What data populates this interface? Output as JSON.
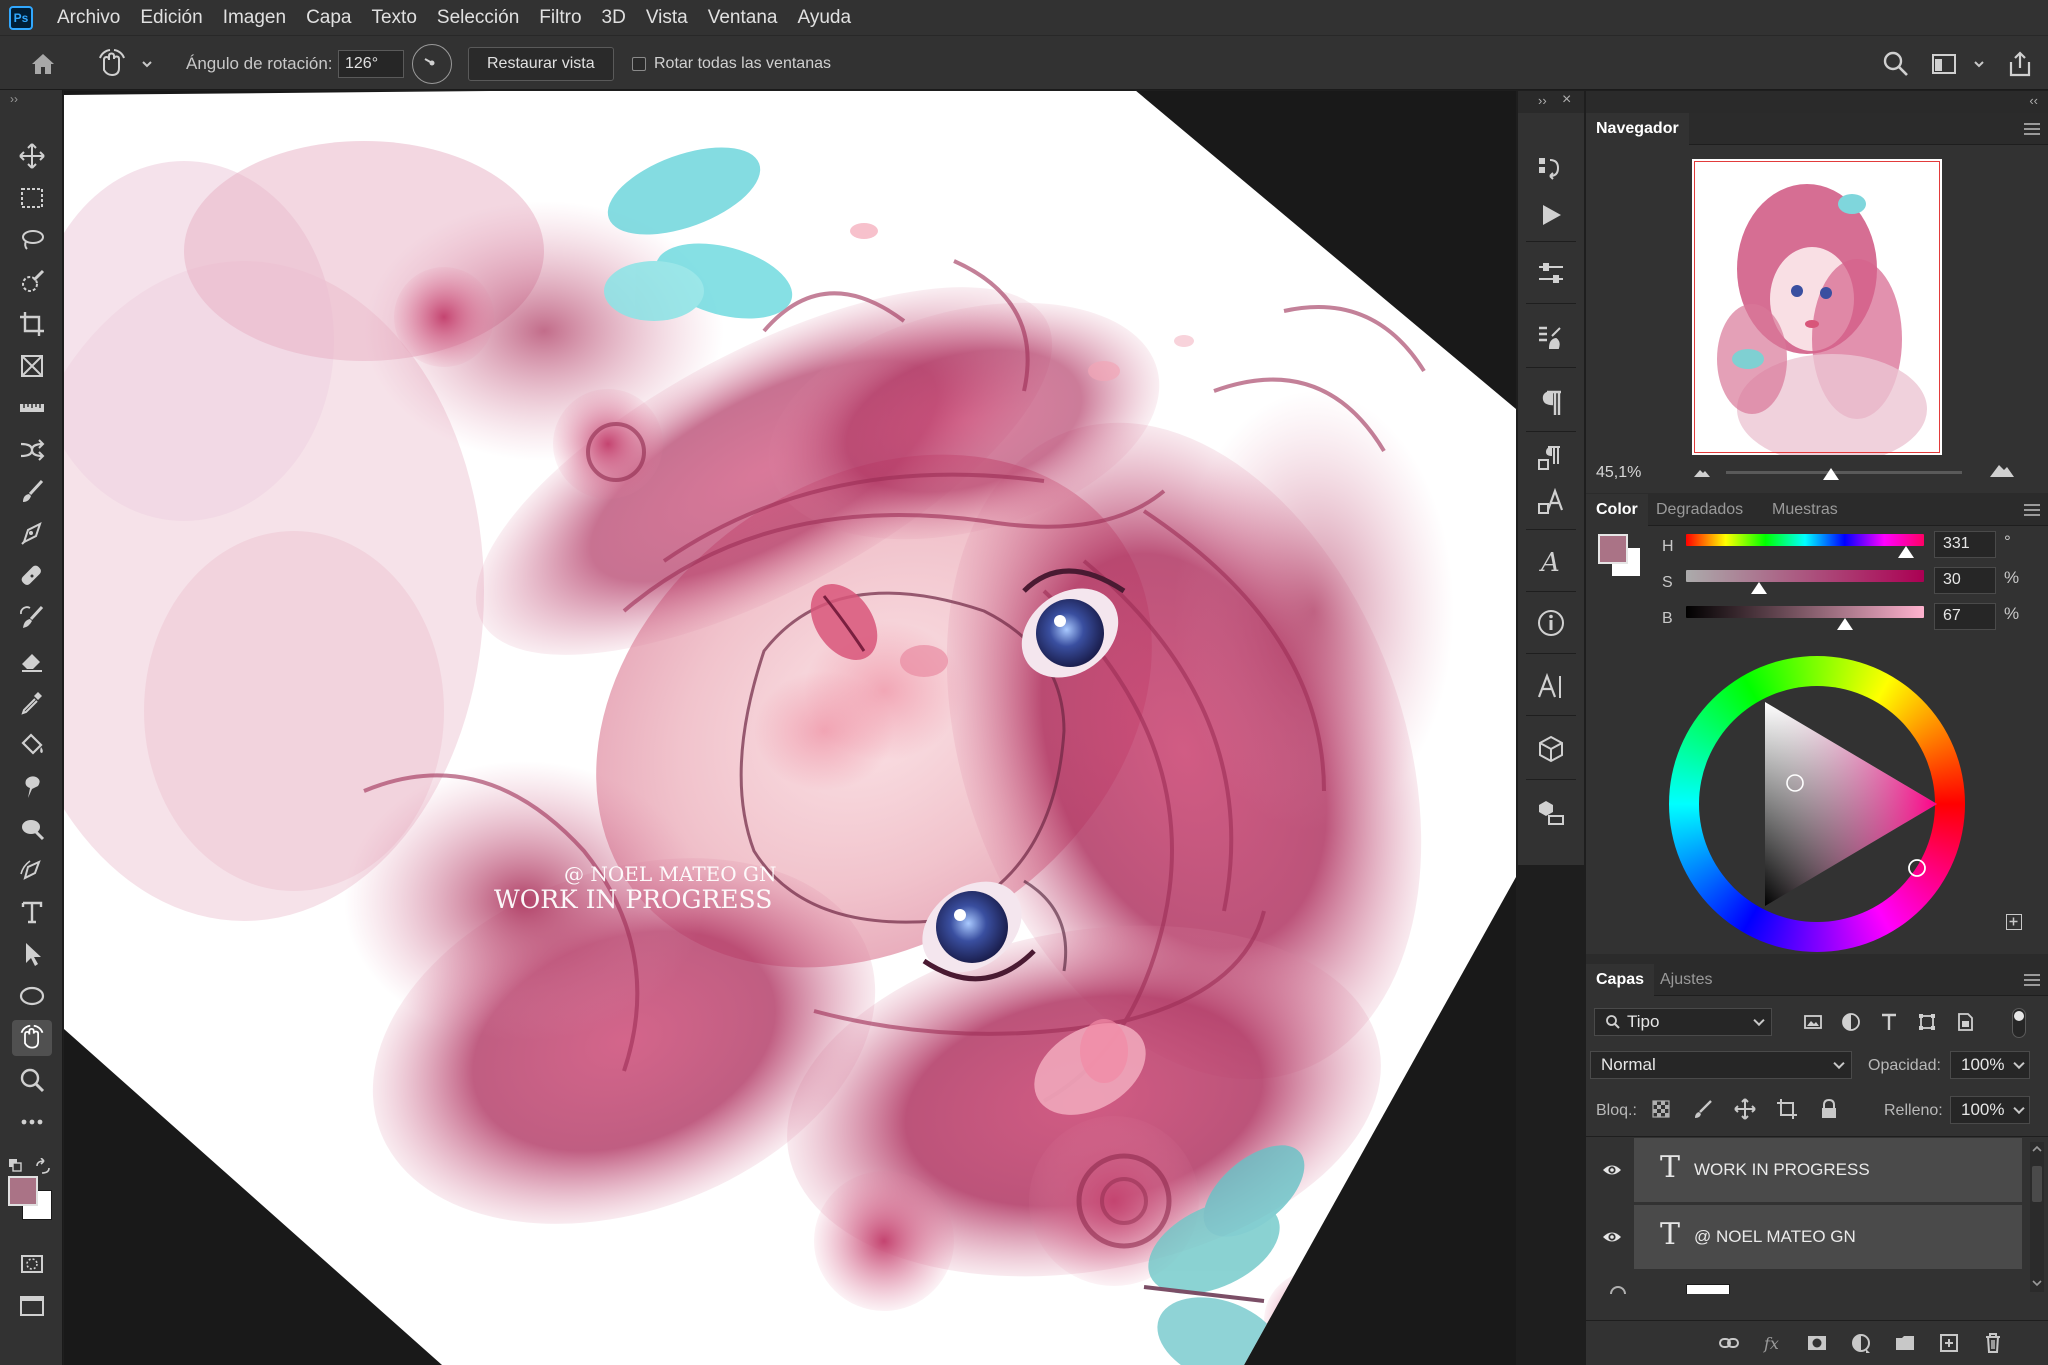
{
  "app": {
    "logo": "Ps"
  },
  "menu": [
    "Archivo",
    "Edición",
    "Imagen",
    "Capa",
    "Texto",
    "Selección",
    "Filtro",
    "3D",
    "Vista",
    "Ventana",
    "Ayuda"
  ],
  "options": {
    "rotation_label": "Ángulo de rotación:",
    "rotation_value": "126°",
    "restore_button": "Restaurar vista",
    "rotate_all_label": "Rotar todas las ventanas",
    "rotate_all_checked": false
  },
  "canvas": {
    "watermark_line1": "@ NOEL MATEO GN",
    "watermark_line2": "WORK IN PROGRESS",
    "rotation_degrees": 126
  },
  "navigator": {
    "title": "Navegador",
    "zoom": "45,1%"
  },
  "color_panel": {
    "tabs": [
      "Color",
      "Degradados",
      "Muestras"
    ],
    "active_tab": "Color",
    "foreground": "#aa7386",
    "background": "#ffffff",
    "h": {
      "label": "H",
      "value": "331",
      "unit": "°"
    },
    "s": {
      "label": "S",
      "value": "30",
      "unit": "%"
    },
    "b": {
      "label": "B",
      "value": "67",
      "unit": "%"
    }
  },
  "layers_panel": {
    "tabs": [
      "Capas",
      "Ajustes"
    ],
    "active_tab": "Capas",
    "filter_label": "Tipo",
    "blend_mode": "Normal",
    "opacity_label": "Opacidad:",
    "opacity_value": "100%",
    "lock_label": "Bloq.:",
    "fill_label": "Relleno:",
    "fill_value": "100%",
    "layers": [
      {
        "name": "WORK IN PROGRESS",
        "type": "text",
        "visible": true
      },
      {
        "name": "@ NOEL MATEO GN",
        "type": "text",
        "visible": true
      }
    ]
  }
}
